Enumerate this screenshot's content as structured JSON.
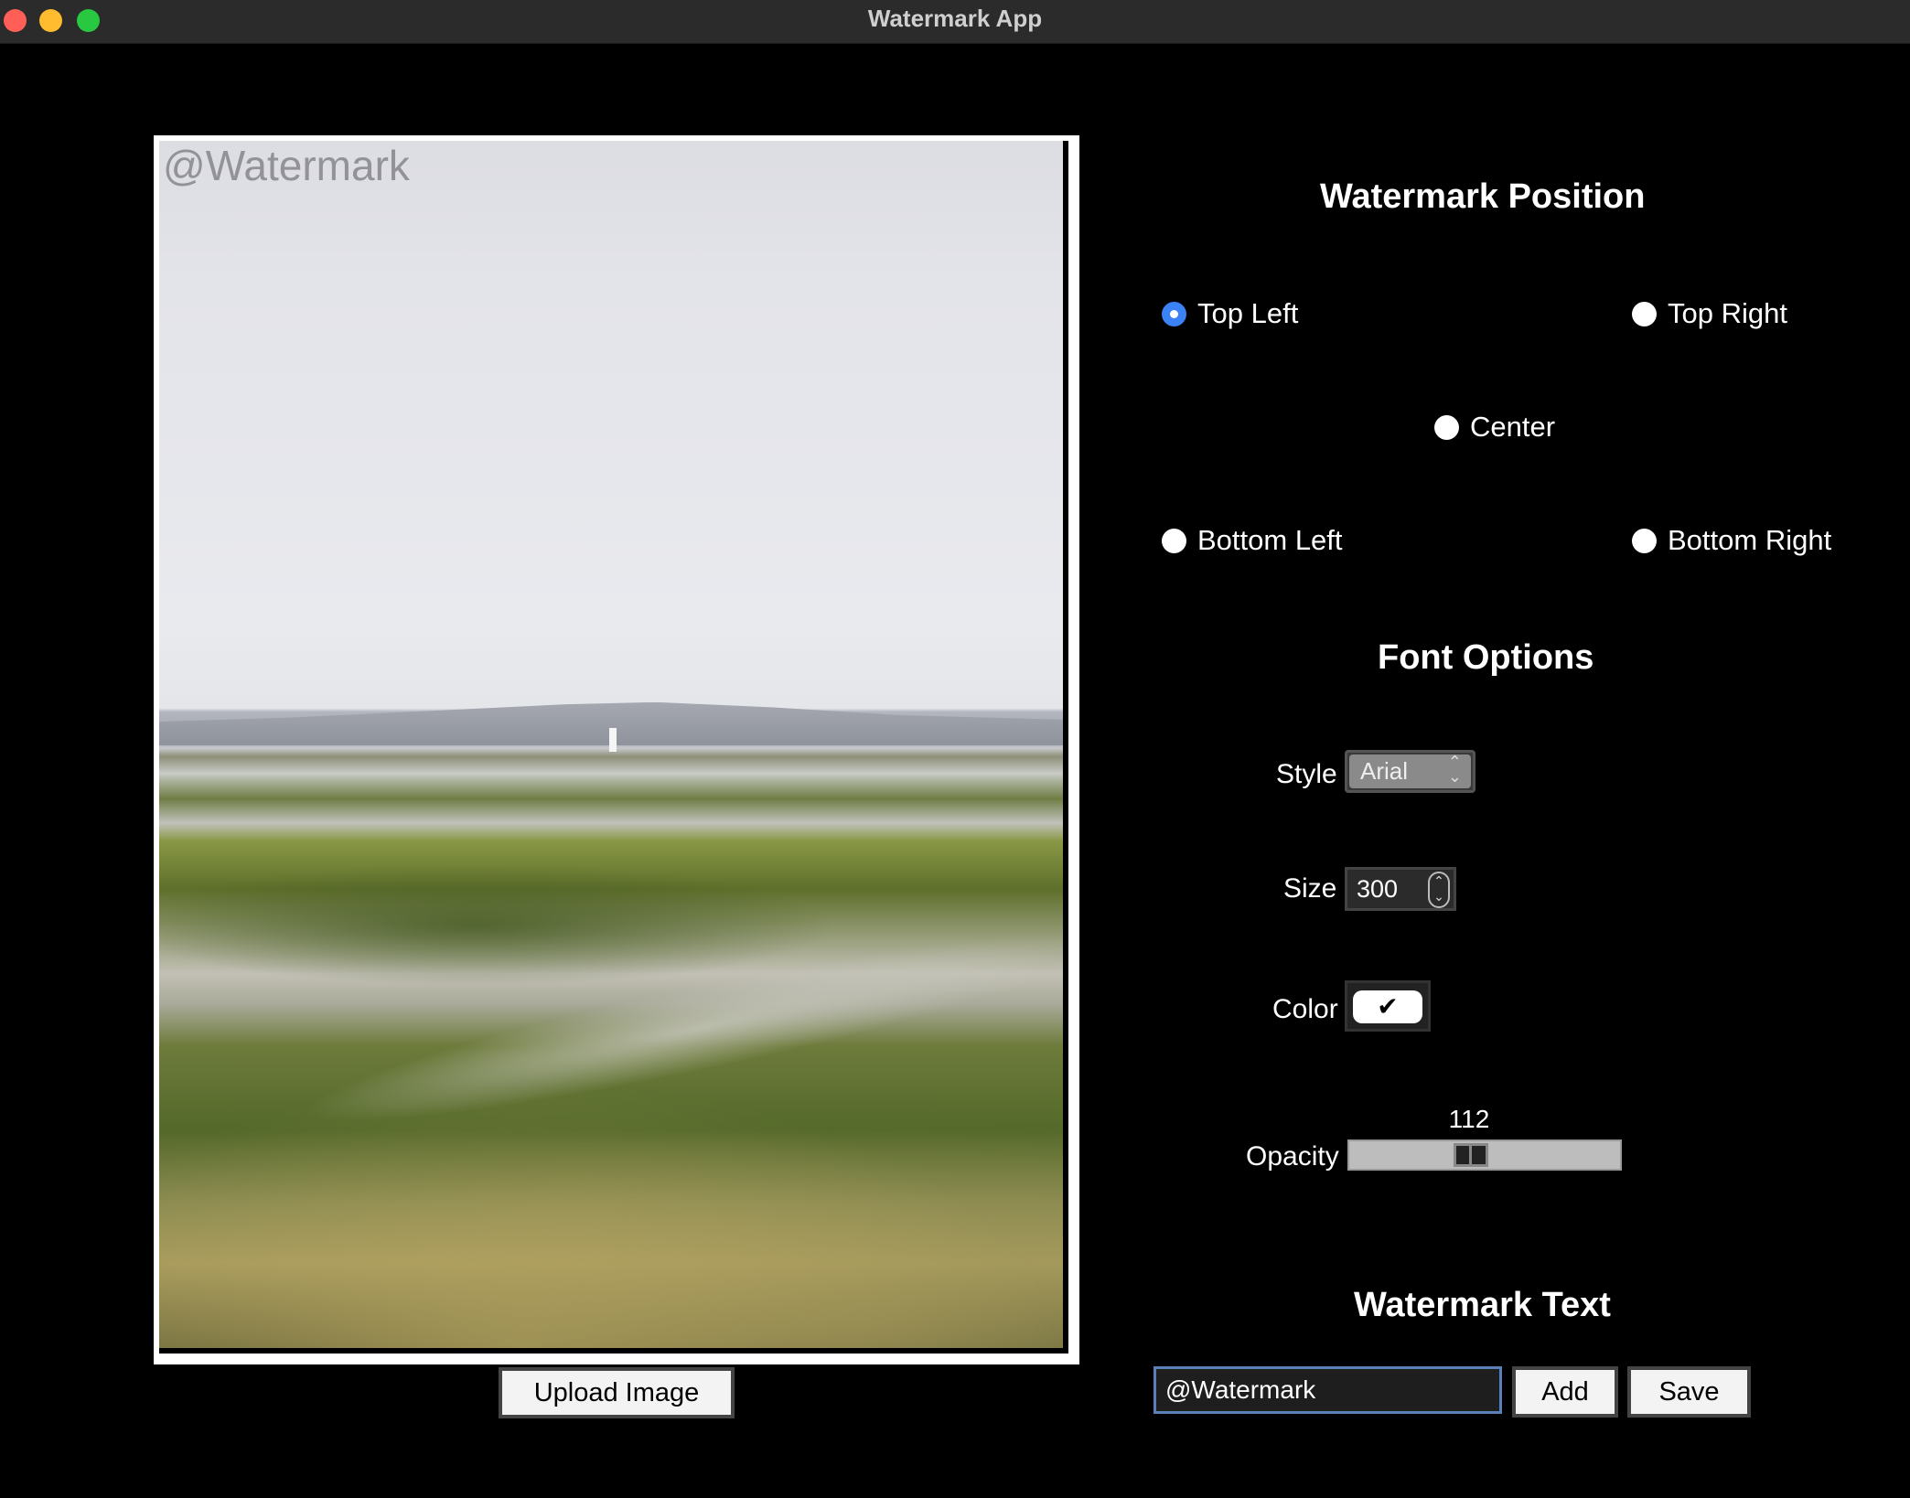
{
  "window": {
    "title": "Watermark App"
  },
  "preview": {
    "watermark_text": "@Watermark",
    "upload_label": "Upload Image"
  },
  "position_section": {
    "title": "Watermark Position",
    "options": [
      {
        "label": "Top Left",
        "selected": true
      },
      {
        "label": "Top Right",
        "selected": false
      },
      {
        "label": "Center",
        "selected": false
      },
      {
        "label": "Bottom Left",
        "selected": false
      },
      {
        "label": "Bottom Right",
        "selected": false
      }
    ]
  },
  "font_section": {
    "title": "Font Options",
    "style_label": "Style",
    "style_value": "Arial",
    "size_label": "Size",
    "size_value": "300",
    "color_label": "Color",
    "color_value": "#ffffff",
    "color_glyph": "✔",
    "opacity_label": "Opacity",
    "opacity_value": "112",
    "opacity_fraction": 0.44
  },
  "text_section": {
    "title": "Watermark Text",
    "input_value": "@Watermark",
    "add_label": "Add",
    "save_label": "Save"
  },
  "colors": {
    "accent": "#3b82f6",
    "background": "#000000"
  }
}
